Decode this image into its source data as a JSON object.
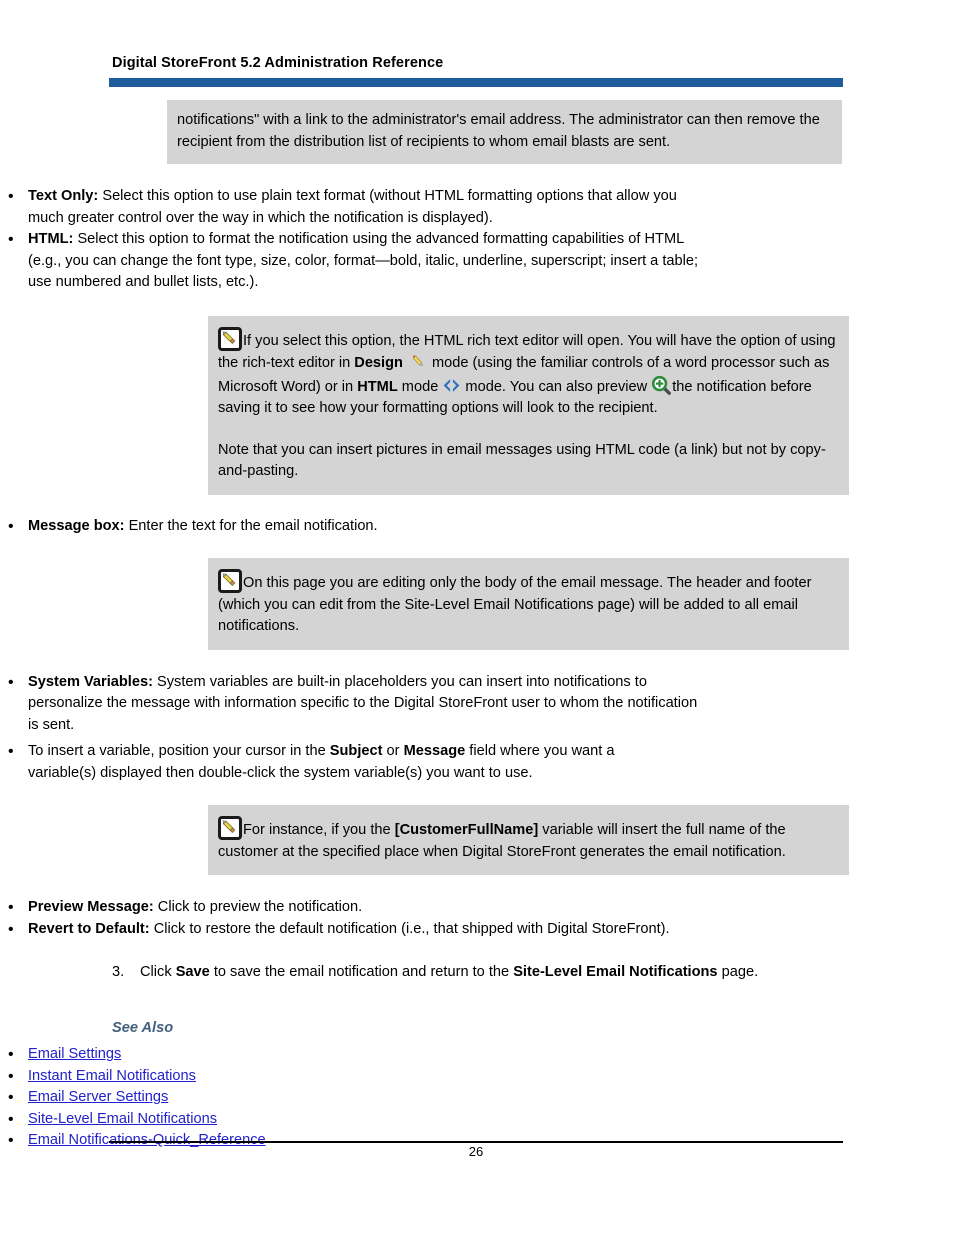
{
  "header": {
    "title": "Digital StoreFront 5.2 Administration Reference",
    "rule_color": "#1F5C9E"
  },
  "colors": {
    "note_box_background": "#D4D4D4",
    "link": "#2222CC",
    "see_also_heading": "#44607C",
    "accent_bar": "#1F5C9E"
  },
  "intro_note": {
    "text": "notifications\" with a link to the administrator's email address. The administrator can then remove the recipient from the distribution list of recipients to whom email blasts are sent."
  },
  "option_bullets": [
    {
      "term": "Text Only:",
      "text": " Select this option to use plain text format (without HTML formatting options that allow you much greater control over the way in which the notification is displayed)."
    },
    {
      "term": "HTML:",
      "text": " Select this option to format the notification using the advanced formatting capabilities of HTML (e.g., you can change the font type, size, color, format—bold, italic, underline, superscript; insert a table; use numbered and bullet lists, etc.)."
    }
  ],
  "note_html_editor": {
    "icon": "note-pencil-icon",
    "p1_part1": "If you select this option, the HTML rich text editor will open. You will have the option of using the rich-text editor in ",
    "p1_design_label": "Design",
    "design_icon": "design-pencil-icon",
    "p1_part2": " mode  (using the familiar controls of a word processor such as Microsoft Word) or in ",
    "p1_html_label": "HTML",
    "html_icon": "code-brackets-icon",
    "p1_part3": " mode ",
    "p1_part4": " mode. You can also preview ",
    "preview_icon": "magnifier-plus-icon",
    "p1_part5": "the notification before saving it to see how your formatting options will look to the recipient.",
    "p2": "Note that you can insert pictures in email messages using HTML code (a link) but not by copy-and-pasting."
  },
  "message_box_bullet": {
    "term": "Message box:",
    "text": " Enter the text for the email notification."
  },
  "note_message_body": {
    "icon": "note-pencil-icon",
    "text": "On this page you are editing only the body of the email message. The header and footer (which you can edit from the Site-Level Email Notifications page) will be added to all email notifications."
  },
  "system_variables_bullet": {
    "term": "System Variables:",
    "text": " System variables are built-in placeholders you can insert into notifications to personalize the message with information specific to the Digital StoreFront user to whom the notification is sent."
  },
  "system_variables_subbullet": {
    "part1": "To insert a variable, position your cursor in the ",
    "bold1": "Subject",
    "part2": " or ",
    "bold2": "Message",
    "part3": " field where you want a variable(s) displayed then double-click the system variable(s) you want to use."
  },
  "note_customer_variable": {
    "icon": "note-pencil-icon",
    "part1": "For instance, if you the ",
    "variable": "[CustomerFullName]",
    "part2": " variable will insert the full name of the customer at the specified place when Digital StoreFront generates the email notification."
  },
  "action_bullets": [
    {
      "term": "Preview Message:",
      "text": " Click to preview the notification."
    },
    {
      "term": "Revert to Default:",
      "text": " Click to restore the default notification (i.e., that shipped with Digital StoreFront)."
    }
  ],
  "step_three": {
    "number": "3.",
    "part1": "Click ",
    "bold1": "Save",
    "part2": " to save the email notification and return to the ",
    "bold2": "Site-Level Email Notifications",
    "part3": " page."
  },
  "see_also": {
    "heading": "See Also",
    "links": [
      "Email Settings",
      "Instant Email Notifications",
      "Email Server Settings",
      "Site-Level Email Notifications",
      "Email Notifications-Quick_Reference"
    ]
  },
  "footer": {
    "page_number": "26"
  },
  "bullet_glyph": "•"
}
